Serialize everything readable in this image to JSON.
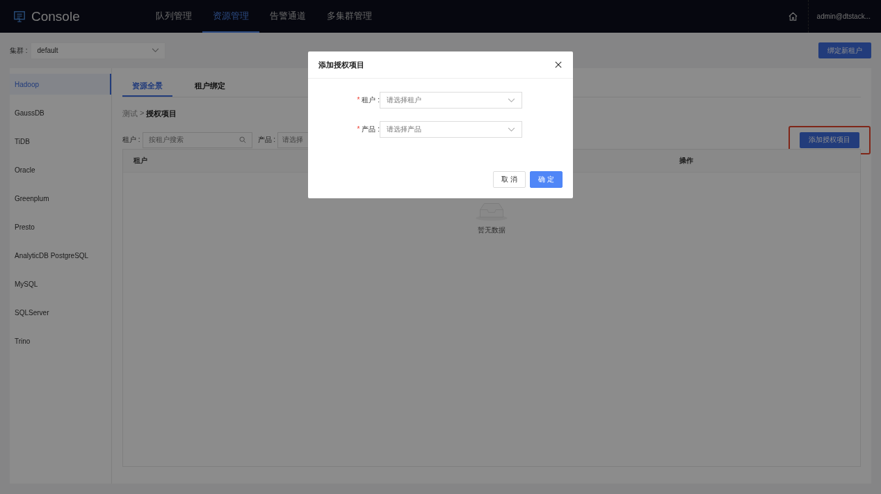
{
  "header": {
    "title": "Console",
    "nav": [
      {
        "label": "队列管理",
        "selected": false
      },
      {
        "label": "资源管理",
        "selected": true
      },
      {
        "label": "告警通道",
        "selected": false
      },
      {
        "label": "多集群管理",
        "selected": false
      }
    ],
    "user": "admin@dtstack..."
  },
  "cluster": {
    "label": "集群 :",
    "value": "default"
  },
  "bind_button": "绑定新租户",
  "sidebar": {
    "items": [
      {
        "label": "Hadoop",
        "selected": true
      },
      {
        "label": "GaussDB",
        "selected": false
      },
      {
        "label": "TiDB",
        "selected": false
      },
      {
        "label": "Oracle",
        "selected": false
      },
      {
        "label": "Greenplum",
        "selected": false
      },
      {
        "label": "Presto",
        "selected": false
      },
      {
        "label": "AnalyticDB PostgreSQL",
        "selected": false
      },
      {
        "label": "MySQL",
        "selected": false
      },
      {
        "label": "SQLServer",
        "selected": false
      },
      {
        "label": "Trino",
        "selected": false
      }
    ]
  },
  "tabs": [
    {
      "label": "资源全景",
      "selected": true
    },
    {
      "label": "租户绑定",
      "selected": false
    }
  ],
  "breadcrumb": {
    "parent": "测试",
    "separator": ">",
    "current": "授权项目"
  },
  "filters": {
    "tenant_label": "租户 :",
    "tenant_placeholder": "按租户搜索",
    "product_label": "产品 :",
    "product_placeholder": "请选择"
  },
  "add_button": {
    "label": "添加授权项目",
    "highlighted": true
  },
  "table": {
    "columns": [
      "租户",
      "操作"
    ],
    "empty_text": "暂无数据"
  },
  "modal": {
    "title": "添加授权项目",
    "required_mark": "*",
    "fields": [
      {
        "label": "租户 :",
        "required": true,
        "placeholder": "请选择租户"
      },
      {
        "label": "产品 :",
        "required": true,
        "placeholder": "请选择产品"
      }
    ],
    "cancel": "取 消",
    "ok": "确 定"
  }
}
